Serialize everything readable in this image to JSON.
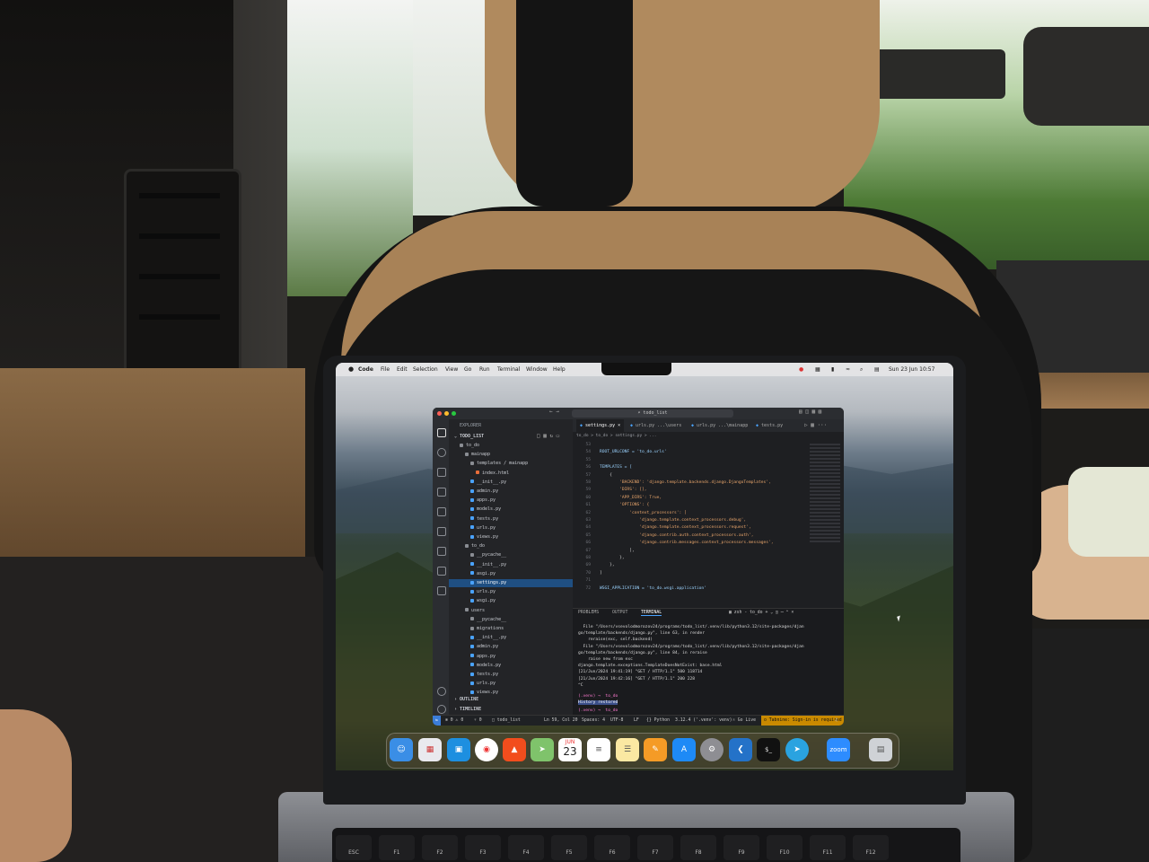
{
  "menubar": {
    "app": "Code",
    "items": [
      "File",
      "Edit",
      "Selection",
      "View",
      "Go",
      "Run",
      "Terminal",
      "Window",
      "Help"
    ],
    "clock": "Sun 23 Jun 10:57"
  },
  "window": {
    "search": "todo_list"
  },
  "explorer": {
    "title": "EXPLORER",
    "project": "TODO_LIST",
    "tree": [
      {
        "label": "to_do",
        "depth": 1,
        "kind": "folder"
      },
      {
        "label": "mainapp",
        "depth": 2,
        "kind": "folder"
      },
      {
        "label": "templates / mainapp",
        "depth": 3,
        "kind": "folder"
      },
      {
        "label": "index.html",
        "depth": 4,
        "kind": "html"
      },
      {
        "label": "__init__.py",
        "depth": 3,
        "kind": "py"
      },
      {
        "label": "admin.py",
        "depth": 3,
        "kind": "py"
      },
      {
        "label": "apps.py",
        "depth": 3,
        "kind": "py"
      },
      {
        "label": "models.py",
        "depth": 3,
        "kind": "py"
      },
      {
        "label": "tests.py",
        "depth": 3,
        "kind": "py"
      },
      {
        "label": "urls.py",
        "depth": 3,
        "kind": "py"
      },
      {
        "label": "views.py",
        "depth": 3,
        "kind": "py"
      },
      {
        "label": "to_do",
        "depth": 2,
        "kind": "folder"
      },
      {
        "label": "__pycache__",
        "depth": 3,
        "kind": "folder"
      },
      {
        "label": "__init__.py",
        "depth": 3,
        "kind": "py"
      },
      {
        "label": "asgi.py",
        "depth": 3,
        "kind": "py"
      },
      {
        "label": "settings.py",
        "depth": 3,
        "kind": "py",
        "selected": true
      },
      {
        "label": "urls.py",
        "depth": 3,
        "kind": "py"
      },
      {
        "label": "wsgi.py",
        "depth": 3,
        "kind": "py"
      },
      {
        "label": "users",
        "depth": 2,
        "kind": "folder"
      },
      {
        "label": "__pycache__",
        "depth": 3,
        "kind": "folder"
      },
      {
        "label": "migrations",
        "depth": 3,
        "kind": "folder"
      },
      {
        "label": "__init__.py",
        "depth": 3,
        "kind": "py"
      },
      {
        "label": "admin.py",
        "depth": 3,
        "kind": "py"
      },
      {
        "label": "apps.py",
        "depth": 3,
        "kind": "py"
      },
      {
        "label": "models.py",
        "depth": 3,
        "kind": "py"
      },
      {
        "label": "tests.py",
        "depth": 3,
        "kind": "py"
      },
      {
        "label": "urls.py",
        "depth": 3,
        "kind": "py"
      },
      {
        "label": "views.py",
        "depth": 3,
        "kind": "py"
      }
    ],
    "outline": "OUTLINE",
    "timeline": "TIMELINE"
  },
  "tabs": [
    {
      "label": "settings.py",
      "active": true
    },
    {
      "label": "urls.py ...\\users",
      "active": false
    },
    {
      "label": "urls.py ...\\mainapp",
      "active": false
    },
    {
      "label": "tests.py",
      "active": false
    }
  ],
  "breadcrumb": "to_do > to_do > settings.py > ...",
  "code": [
    {
      "n": "53",
      "text": ""
    },
    {
      "n": "54",
      "text": "ROOT_URLCONF = 'to_do.urls'"
    },
    {
      "n": "55",
      "text": ""
    },
    {
      "n": "56",
      "text": "TEMPLATES = ["
    },
    {
      "n": "57",
      "text": "    {"
    },
    {
      "n": "58",
      "text": "        'BACKEND': 'django.template.backends.django.DjangoTemplates',"
    },
    {
      "n": "59",
      "text": "        'DIRS': [],"
    },
    {
      "n": "60",
      "text": "        'APP_DIRS': True,"
    },
    {
      "n": "61",
      "text": "        'OPTIONS': {"
    },
    {
      "n": "62",
      "text": "            'context_processors': ["
    },
    {
      "n": "63",
      "text": "                'django.template.context_processors.debug',"
    },
    {
      "n": "64",
      "text": "                'django.template.context_processors.request',"
    },
    {
      "n": "65",
      "text": "                'django.contrib.auth.context_processors.auth',"
    },
    {
      "n": "66",
      "text": "                'django.contrib.messages.context_processors.messages',"
    },
    {
      "n": "67",
      "text": "            ],"
    },
    {
      "n": "68",
      "text": "        },"
    },
    {
      "n": "69",
      "text": "    },"
    },
    {
      "n": "70",
      "text": "]"
    },
    {
      "n": "71",
      "text": ""
    },
    {
      "n": "72",
      "text": "WSGI_APPLICATION = 'to_do.wsgi.application'"
    }
  ],
  "panel": {
    "tabs": [
      "PROBLEMS",
      "OUTPUT",
      "TERMINAL"
    ],
    "active": "TERMINAL",
    "shell": "zsh - to_do",
    "lines": [
      "  File \"/Users/vsevolodmorozov24/programs/todo_list/.venv/lib/python3.12/site-packages/djan",
      "go/template/backends/django.py\", line 63, in render",
      "    reraise(exc, self.backend)",
      "  File \"/Users/vsevolodmorozov24/programs/todo_list/.venv/lib/python3.12/site-packages/djan",
      "go/template/backends/django.py\", line 84, in reraise",
      "    raise new from exc",
      "django.template.exceptions.TemplateDoesNotExist: base.html",
      "[21/Jun/2024 19:41:19] \"GET / HTTP/1.1\" 500 118714",
      "[21/Jun/2024 19:42:16] \"GET / HTTP/1.1\" 200 228",
      "^C"
    ],
    "prompt1": "(.venv) →  to_do",
    "history": "History restored",
    "prompt2": "(.venv) →  to_do"
  },
  "status": {
    "errors": "⊗ 0 ⚠ 0",
    "ports": "▿ 0",
    "project": "todo_list",
    "position": "Ln 59, Col 20",
    "spaces": "Spaces: 4",
    "encoding": "UTF-8",
    "eol": "LF",
    "language": "{} Python",
    "interpreter": "3.12.4 ('.venv': venv)",
    "golive": "Go Live",
    "tabnine": "o Tabnine: Sign-in is required"
  },
  "dock": {
    "calendar_month": "JUN",
    "calendar_day": "23",
    "zoom": "zoom",
    "icons": [
      "finder-icon",
      "launchpad-icon",
      "docker-icon",
      "chrome-icon",
      "brave-icon",
      "maps-icon",
      "calendar-icon",
      "reminders-icon",
      "notes-icon",
      "pages-icon",
      "appstore-icon",
      "settings-icon",
      "vscode-icon",
      "terminal-icon",
      "telegram-icon",
      "zoom-icon",
      "trash-icon"
    ]
  },
  "keyboard": [
    "ESC",
    "F1",
    "F2",
    "F3",
    "F4",
    "F5",
    "F6",
    "F7",
    "F8",
    "F9",
    "F10",
    "F11",
    "F12"
  ],
  "colors": {
    "accent": "#1f4f82",
    "tabnine": "#c98a00",
    "terminal_prompt": "#ff7bd0"
  }
}
